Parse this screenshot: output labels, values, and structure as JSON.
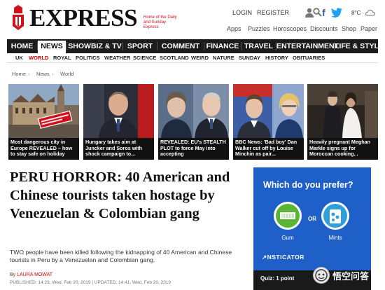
{
  "masthead": {
    "logo_text": "EXPRESS",
    "logo_subtitle": "Home of the Daily and Sunday Express",
    "top_links": [
      "LOGIN",
      "REGISTER"
    ],
    "temperature": "8°C",
    "sub_links": [
      "Apps",
      "Puzzles",
      "Horoscopes",
      "Discounts",
      "Shop",
      "Paper"
    ],
    "icons": [
      "express-crest-icon",
      "user-icon",
      "search-icon",
      "facebook-icon",
      "twitter-icon",
      "weather-cloud-icon"
    ]
  },
  "main_nav": {
    "items": [
      "HOME",
      "NEWS",
      "SHOWBIZ & TV",
      "SPORT",
      "COMMENT",
      "FINANCE",
      "TRAVEL",
      "ENTERTAINMENT",
      "LIFE & STYLE"
    ],
    "active": "NEWS"
  },
  "sub_nav": {
    "items": [
      "UK",
      "WORLD",
      "ROYAL",
      "POLITICS",
      "WEATHER",
      "SCIENCE",
      "SCOTLAND",
      "WEIRD",
      "NATURE",
      "SUNDAY",
      "HISTORY",
      "OBITUARIES"
    ],
    "active": "WORLD"
  },
  "breadcrumb": [
    "Home",
    "News",
    "World"
  ],
  "cards": [
    {
      "caption": "Most dangerous city in Europe REVEALED – how to stay safe on holiday"
    },
    {
      "caption": "Hungary takes aim at Juncker and Soros with shock campaign to..."
    },
    {
      "caption": "REVEALED: EU's STEALTH PLOT to force May into accepting"
    },
    {
      "caption": "BBC News: 'Bad boy' Dan Walker cut off by Louise Minchin as pair..."
    },
    {
      "caption": "Heavily pregnant Meghan Markle signs up for Moroccan cooking..."
    }
  ],
  "article": {
    "headline": "PERU HORROR: 40 American and Chinese tourists taken hostage by Venezuelan & Colombian gang",
    "standfirst": "TWO people have been killed following the kidnapping of 40 American and Chinese tourists in Peru by a Venezuelan and Colombian gang.",
    "byline_prefix": "By",
    "author": "LAURA MOWAT",
    "published": "PUBLISHED: 14:29, Wed, Feb 20, 2019 | UPDATED: 14:41, Wed, Feb 20, 2019"
  },
  "quiz": {
    "title": "Which do you prefer?",
    "option_a": "Gum",
    "option_b": "Mints",
    "or_label": "OR",
    "brand": "↗NSTICATOR",
    "footer": "Quiz: 1 point",
    "accent": "#1f5fc8",
    "option_a_color": "#5bb534",
    "option_b_color": "#2e9fd8"
  },
  "watermark": {
    "text": "悟空问答"
  },
  "colors": {
    "brand_red": "#d0101d",
    "nav_bg": "#1c1c1c",
    "link_red": "#cc0000"
  }
}
